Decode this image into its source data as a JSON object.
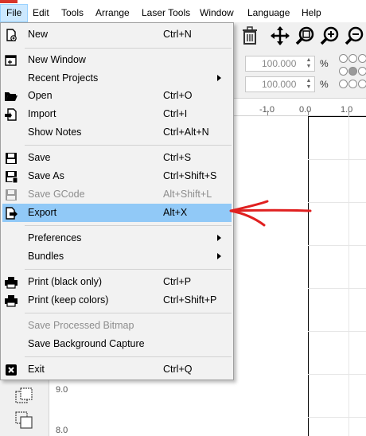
{
  "menubar": {
    "items": [
      "File",
      "Edit",
      "Tools",
      "Arrange",
      "Laser Tools",
      "Window",
      "Language",
      "Help"
    ]
  },
  "toolbar": {
    "icons": [
      "trash-icon",
      "move-icon",
      "zoom-fit-icon",
      "zoom-in-icon",
      "zoom-out-icon"
    ]
  },
  "properties": {
    "width_scale": "100.000",
    "height_scale": "100.000",
    "unit": "%"
  },
  "rulers": {
    "top": [
      "-1.0",
      "0.0",
      "1.0"
    ],
    "left": [
      "9.0",
      "8.0"
    ]
  },
  "file_menu": {
    "new": {
      "label": "New",
      "shortcut": "Ctrl+N"
    },
    "new_window": {
      "label": "New Window",
      "shortcut": ""
    },
    "recent_projects": {
      "label": "Recent Projects",
      "shortcut": ""
    },
    "open": {
      "label": "Open",
      "shortcut": "Ctrl+O"
    },
    "import": {
      "label": "Import",
      "shortcut": "Ctrl+I"
    },
    "show_notes": {
      "label": "Show Notes",
      "shortcut": "Ctrl+Alt+N"
    },
    "save": {
      "label": "Save",
      "shortcut": "Ctrl+S"
    },
    "save_as": {
      "label": "Save As",
      "shortcut": "Ctrl+Shift+S"
    },
    "save_gcode": {
      "label": "Save GCode",
      "shortcut": "Alt+Shift+L"
    },
    "export": {
      "label": "Export",
      "shortcut": "Alt+X"
    },
    "preferences": {
      "label": "Preferences",
      "shortcut": ""
    },
    "bundles": {
      "label": "Bundles",
      "shortcut": ""
    },
    "print_black": {
      "label": "Print (black only)",
      "shortcut": "Ctrl+P"
    },
    "print_colors": {
      "label": "Print (keep colors)",
      "shortcut": "Ctrl+Shift+P"
    },
    "save_processed_bitmap": {
      "label": "Save Processed Bitmap",
      "shortcut": ""
    },
    "save_background_capture": {
      "label": "Save Background Capture",
      "shortcut": ""
    },
    "exit": {
      "label": "Exit",
      "shortcut": "Ctrl+Q"
    }
  },
  "colors": {
    "highlight": "#91c9f7",
    "annotation": "#e02020",
    "menu_active": "#cce8ff"
  }
}
